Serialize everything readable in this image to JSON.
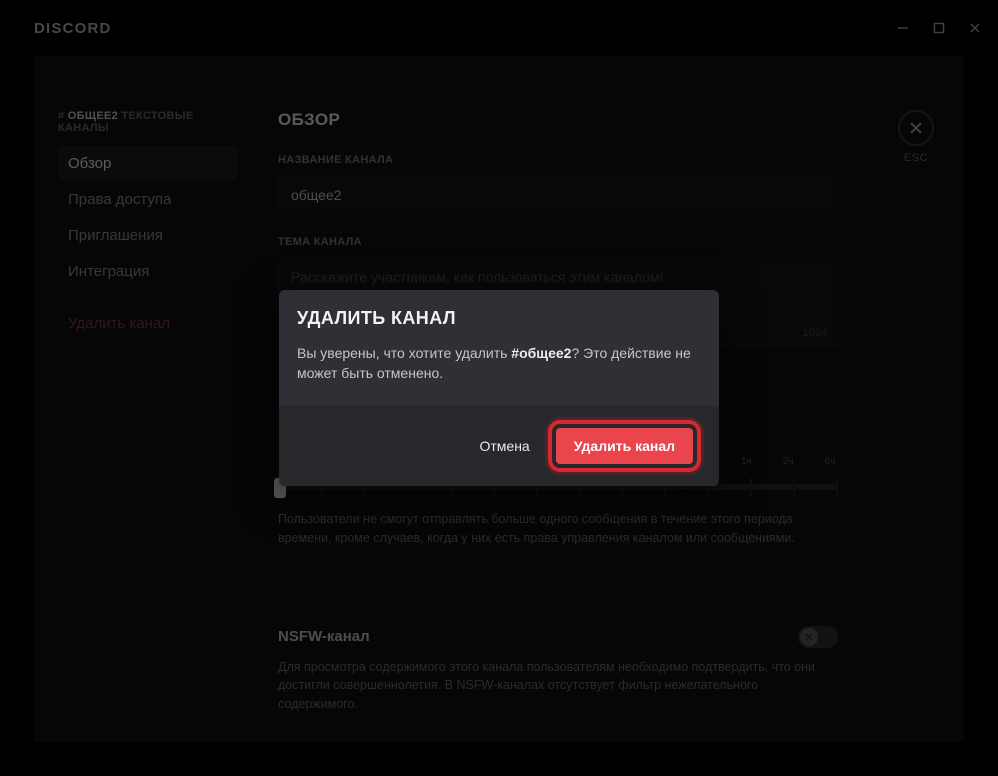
{
  "app_name": "DISCORD",
  "window_controls": {
    "min": "–",
    "max": "□",
    "close": "✕"
  },
  "esc": {
    "label": "ESC"
  },
  "sidebar": {
    "breadcrumb_hash": "#",
    "breadcrumb_channel": "ОБЩЕЕ2",
    "breadcrumb_suffix": "ТЕКСТОВЫЕ КАНАЛЫ",
    "items": [
      {
        "label": "Обзор"
      },
      {
        "label": "Права доступа"
      },
      {
        "label": "Приглашения"
      },
      {
        "label": "Интеграция"
      }
    ],
    "delete_label": "Удалить канал"
  },
  "page": {
    "title": "ОБЗОР",
    "name_label": "НАЗВАНИЕ КАНАЛА",
    "name_value": "общее2",
    "topic_label": "ТЕМА КАНАЛА",
    "topic_placeholder": "Расскажите участникам, как пользоваться этим каналом!",
    "topic_char_limit": "1024",
    "slowmode_help": "Пользователи не смогут отправлять больше одного сообщения в течение этого периода времени, кроме случаев, когда у них есть права управления каналом или сообщениями.",
    "slider_ticks": [
      "",
      "",
      "",
      "",
      "",
      "",
      "",
      "",
      "",
      "",
      "",
      "1ч",
      "2ч",
      "6ч"
    ],
    "nsfw_title": "NSFW-канал",
    "nsfw_help": "Для просмотра содержимого этого канала пользователям необходимо подтвердить, что они достигли совершеннолетия. В NSFW-каналах отсутствует фильтр нежелательного содержимого."
  },
  "modal": {
    "title": "УДАЛИТЬ КАНАЛ",
    "text_prefix": "Вы уверены, что хотите удалить ",
    "text_bold": "#общее2",
    "text_suffix": "? Это действие не может быть отменено.",
    "cancel": "Отмена",
    "confirm": "Удалить канал"
  }
}
